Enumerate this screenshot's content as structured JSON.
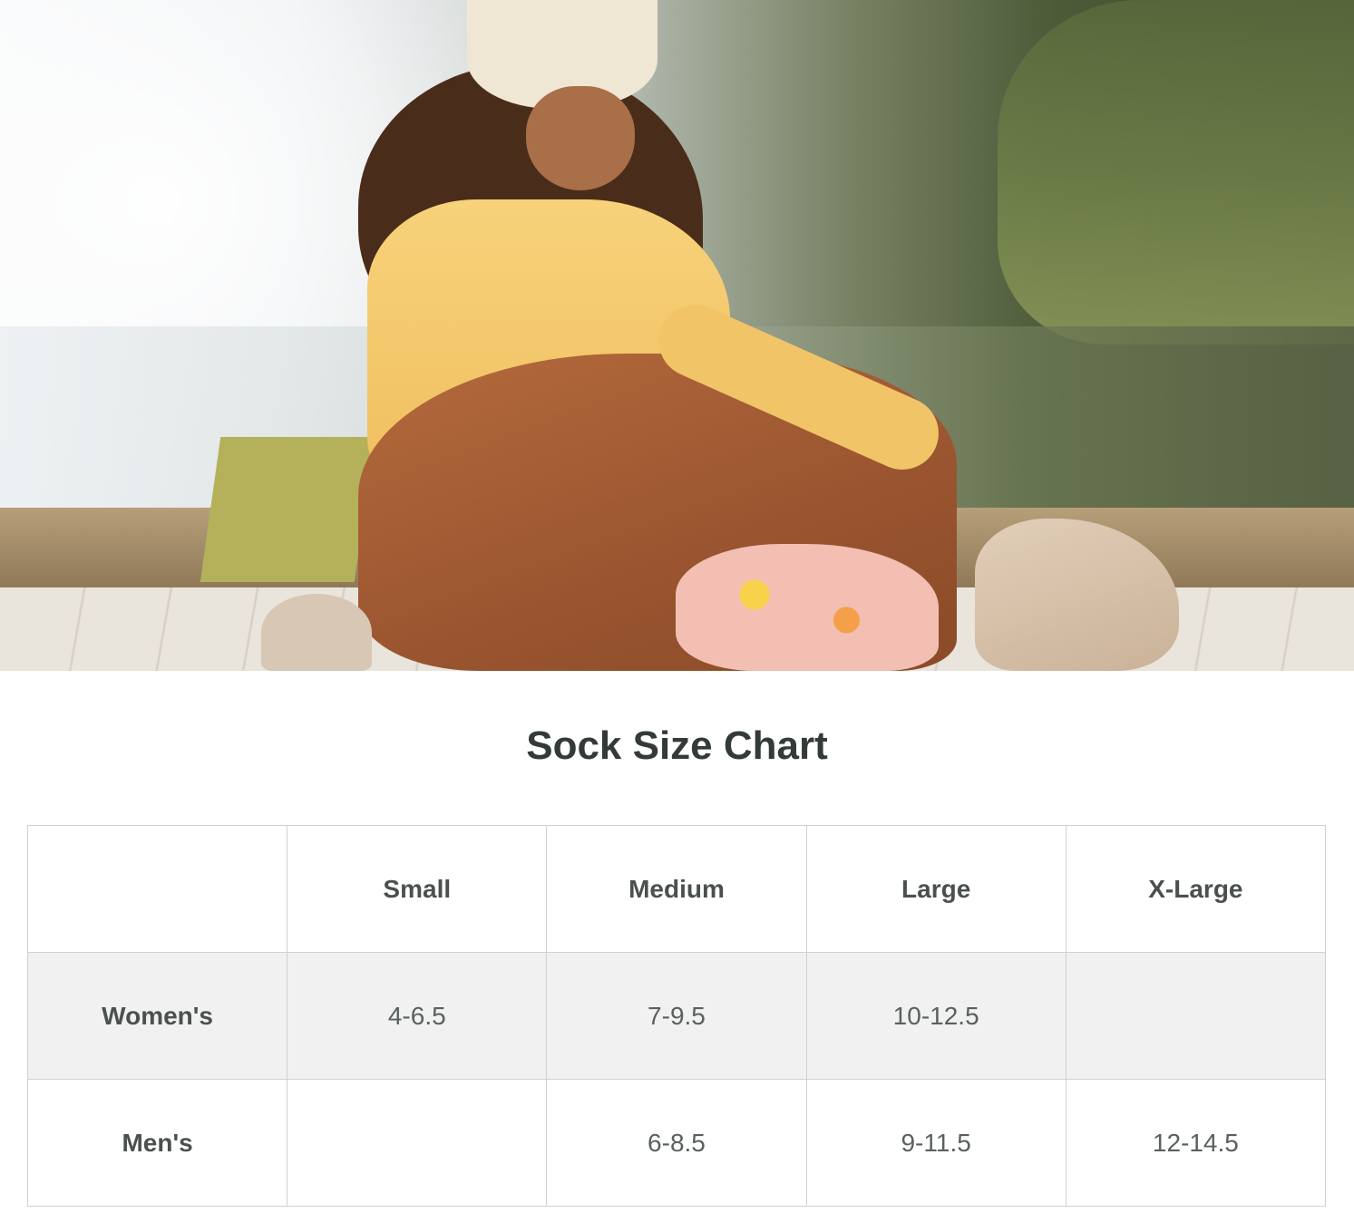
{
  "photo": {
    "subject": "hero-lifestyle-photo"
  },
  "title": "Sock Size Chart",
  "table": {
    "columns": [
      "",
      "Small",
      "Medium",
      "Large",
      "X-Large"
    ],
    "rows": [
      {
        "label": "Women's",
        "cells": [
          "4-6.5",
          "7-9.5",
          "10-12.5",
          ""
        ]
      },
      {
        "label": "Men's",
        "cells": [
          "",
          "6-8.5",
          "9-11.5",
          "12-14.5"
        ]
      }
    ]
  },
  "colors": {
    "title_text": "#333a3a",
    "table_border": "#cfd2d2",
    "row_shade": "#f1f1f1"
  }
}
